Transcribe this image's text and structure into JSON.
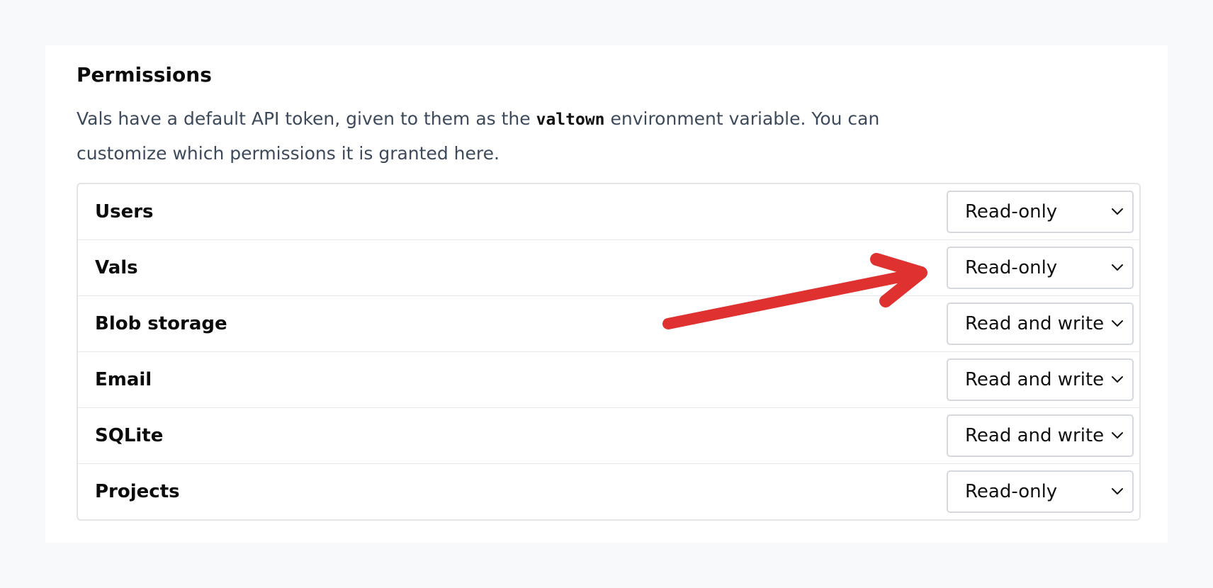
{
  "section": {
    "title": "Permissions",
    "description_before": "Vals have a default API token, given to them as the ",
    "description_code": "valtown",
    "description_after": " environment variable. You can customize which permissions it is granted here."
  },
  "permissions": [
    {
      "label": "Users",
      "value": "Read-only"
    },
    {
      "label": "Vals",
      "value": "Read-only"
    },
    {
      "label": "Blob storage",
      "value": "Read and write"
    },
    {
      "label": "Email",
      "value": "Read and write"
    },
    {
      "label": "SQLite",
      "value": "Read and write"
    },
    {
      "label": "Projects",
      "value": "Read-only"
    }
  ],
  "icons": {
    "dropdown": "chevron-down-icon",
    "annotation": "red-arrow-icon"
  },
  "colors": {
    "annotation_arrow": "#e03131"
  }
}
